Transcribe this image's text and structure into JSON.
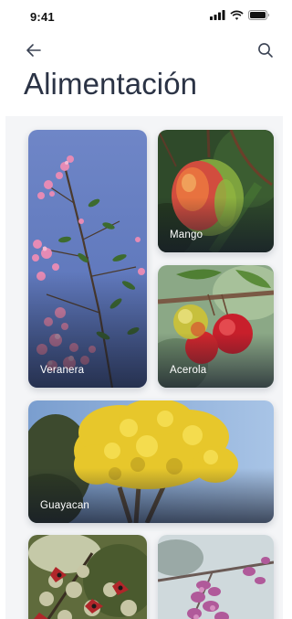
{
  "status": {
    "time": "9:41"
  },
  "nav": {
    "back_icon": "arrow-left-icon",
    "search_icon": "search-icon"
  },
  "page": {
    "title": "Alimentación"
  },
  "colors": {
    "title": "#2b3345",
    "grid_bg": "#f4f5f7",
    "label": "#ffffff"
  },
  "cards": [
    {
      "label": "Veranera"
    },
    {
      "label": "Mango"
    },
    {
      "label": "Acerola"
    },
    {
      "label": "Guayacan"
    },
    {
      "label": ""
    },
    {
      "label": ""
    }
  ]
}
